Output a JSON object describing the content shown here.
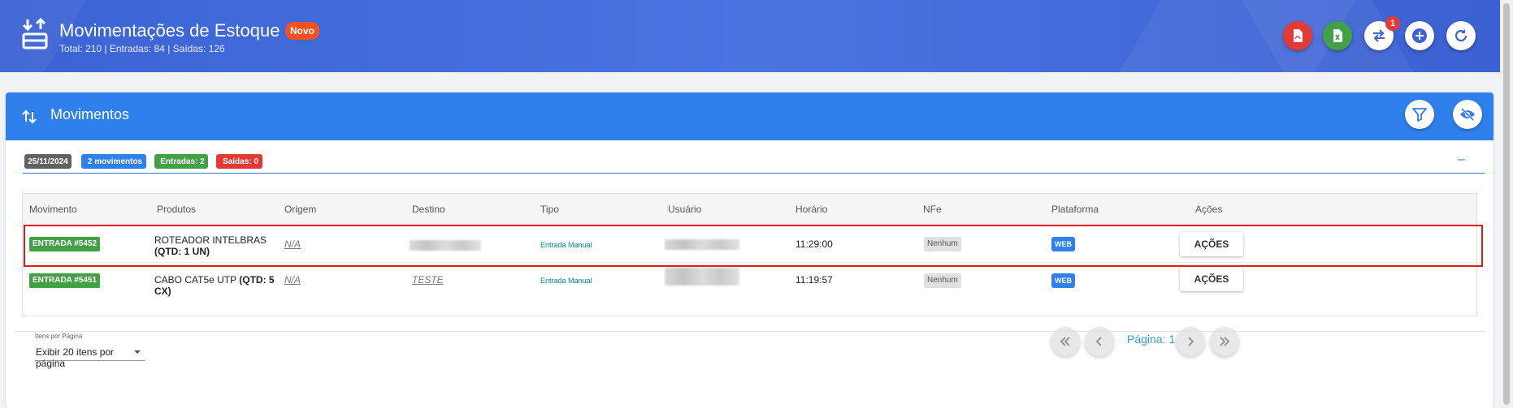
{
  "header": {
    "title": "Movimentações de Estoque",
    "badge": "Novo",
    "subtitle": "Total: 210 | Entradas: 84 | Saídas: 126",
    "notification_count": "1",
    "colors": {
      "background": "#3b63d4",
      "pdf": "#e53935",
      "excel": "#43a047",
      "badge": "#f4511e"
    },
    "buttons": [
      {
        "name": "export-pdf",
        "icon": "pdf-file-icon"
      },
      {
        "name": "export-excel",
        "icon": "excel-file-icon"
      },
      {
        "name": "transfer",
        "icon": "swap-arrows-icon"
      },
      {
        "name": "add",
        "icon": "plus-circle-icon"
      },
      {
        "name": "refresh",
        "icon": "refresh-icon"
      }
    ]
  },
  "card": {
    "title": "Movimentos",
    "accent": "#2f80ed"
  },
  "chips": {
    "date": "25/11/2024",
    "movements": "2 movimentos",
    "entradas": "Entradas: 2",
    "saidas": "Saídas: 0"
  },
  "table": {
    "columns": [
      "Movimento",
      "Produtos",
      "Origem",
      "Destino",
      "Tipo",
      "Usuário",
      "Horário",
      "NFe",
      "Plataforma",
      "Ações"
    ],
    "rows": [
      {
        "movimento": "ENTRADA #5452",
        "produto_nome": "ROTEADOR INTELBRAS ",
        "produto_qtd": "(QTD: 1 UN)",
        "origem": "N/A",
        "destino": "",
        "tipo": "Entrada Manual",
        "horario": "11:29:00",
        "nfe": "Nenhum",
        "plataforma": "WEB",
        "acoes": "AÇÕES"
      },
      {
        "movimento": "ENTRADA #5451",
        "produto_nome": "CABO CAT5e UTP ",
        "produto_qtd": "(QTD: 5 CX)",
        "origem": "N/A",
        "destino": "TESTE",
        "tipo": "Entrada Manual",
        "horario": "11:19:57",
        "nfe": "Nenhum",
        "plataforma": "WEB",
        "acoes": "AÇÕES"
      }
    ]
  },
  "footer": {
    "items_per_page_label": "Itens por Página",
    "items_per_page_value": "Exibir 20 itens por página",
    "page_label": "Página: 1"
  }
}
